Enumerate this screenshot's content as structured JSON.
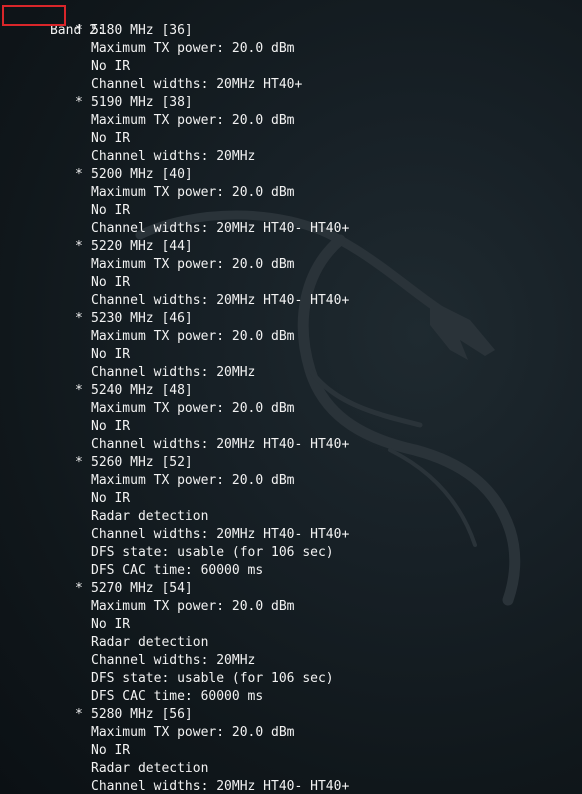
{
  "band_header": "Band 2:",
  "bullet_char": "*",
  "channels": [
    {
      "freq": "5180 MHz [36]",
      "details": [
        "Maximum TX power: 20.0 dBm",
        "No IR",
        "Channel widths: 20MHz HT40+"
      ]
    },
    {
      "freq": "5190 MHz [38]",
      "details": [
        "Maximum TX power: 20.0 dBm",
        "No IR",
        "Channel widths: 20MHz"
      ]
    },
    {
      "freq": "5200 MHz [40]",
      "details": [
        "Maximum TX power: 20.0 dBm",
        "No IR",
        "Channel widths: 20MHz HT40- HT40+"
      ]
    },
    {
      "freq": "5220 MHz [44]",
      "details": [
        "Maximum TX power: 20.0 dBm",
        "No IR",
        "Channel widths: 20MHz HT40- HT40+"
      ]
    },
    {
      "freq": "5230 MHz [46]",
      "details": [
        "Maximum TX power: 20.0 dBm",
        "No IR",
        "Channel widths: 20MHz"
      ]
    },
    {
      "freq": "5240 MHz [48]",
      "details": [
        "Maximum TX power: 20.0 dBm",
        "No IR",
        "Channel widths: 20MHz HT40- HT40+"
      ]
    },
    {
      "freq": "5260 MHz [52]",
      "details": [
        "Maximum TX power: 20.0 dBm",
        "No IR",
        "Radar detection",
        "Channel widths: 20MHz HT40- HT40+",
        "DFS state: usable (for 106 sec)",
        "DFS CAC time: 60000 ms"
      ]
    },
    {
      "freq": "5270 MHz [54]",
      "details": [
        "Maximum TX power: 20.0 dBm",
        "No IR",
        "Radar detection",
        "Channel widths: 20MHz",
        "DFS state: usable (for 106 sec)",
        "DFS CAC time: 60000 ms"
      ]
    },
    {
      "freq": "5280 MHz [56]",
      "details": [
        "Maximum TX power: 20.0 dBm",
        "No IR",
        "Radar detection",
        "Channel widths: 20MHz HT40- HT40+"
      ]
    }
  ],
  "colors": {
    "text": "#f2f2f2",
    "highlight_box": "#d9262a",
    "background": "#10171b",
    "watermark": "#2c353b"
  },
  "icons": {
    "watermark": "kali-dragon-icon"
  }
}
